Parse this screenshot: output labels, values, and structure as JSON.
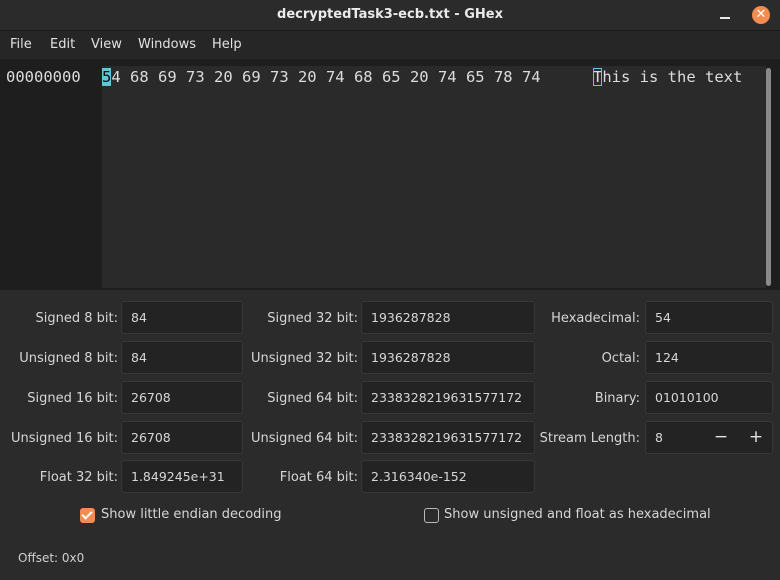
{
  "window": {
    "title": "decryptedTask3-ecb.txt - GHex"
  },
  "menu": [
    "File",
    "Edit",
    "View",
    "Windows",
    "Help"
  ],
  "hex": {
    "offset": "00000000",
    "cursor_byte": "5",
    "bytes_rest": "4 68 69 73 20 69 73 20 74 68 65 20 74 65 78 74",
    "cursor_char": "T",
    "ascii_rest": "his is the text"
  },
  "converter": {
    "signed8_label": "Signed 8 bit:",
    "signed8": "84",
    "unsigned8_label": "Unsigned 8 bit:",
    "unsigned8": "84",
    "signed16_label": "Signed 16 bit:",
    "signed16": "26708",
    "unsigned16_label": "Unsigned 16 bit:",
    "unsigned16": "26708",
    "float32_label": "Float 32 bit:",
    "float32": "1.849245e+31",
    "signed32_label": "Signed 32 bit:",
    "signed32": "1936287828",
    "unsigned32_label": "Unsigned 32 bit:",
    "unsigned32": "1936287828",
    "signed64_label": "Signed 64 bit:",
    "signed64": "2338328219631577172",
    "unsigned64_label": "Unsigned 64 bit:",
    "unsigned64": "2338328219631577172",
    "float64_label": "Float 64 bit:",
    "float64": "2.316340e-152",
    "hex_label": "Hexadecimal:",
    "hexadecimal": "54",
    "octal_label": "Octal:",
    "octal": "124",
    "binary_label": "Binary:",
    "binary": "01010100",
    "stream_label": "Stream Length:",
    "stream_length": "8",
    "stream_minus": "−",
    "stream_plus": "+"
  },
  "options": {
    "little_endian_label": "Show little endian decoding",
    "little_endian_checked": true,
    "unsigned_hex_label": "Show unsigned and float as hexadecimal",
    "unsigned_hex_checked": false
  },
  "status": {
    "offset_text": "Offset: 0x0"
  },
  "colors": {
    "accent": "#f28c50",
    "cursor": "#5fc8d8"
  }
}
